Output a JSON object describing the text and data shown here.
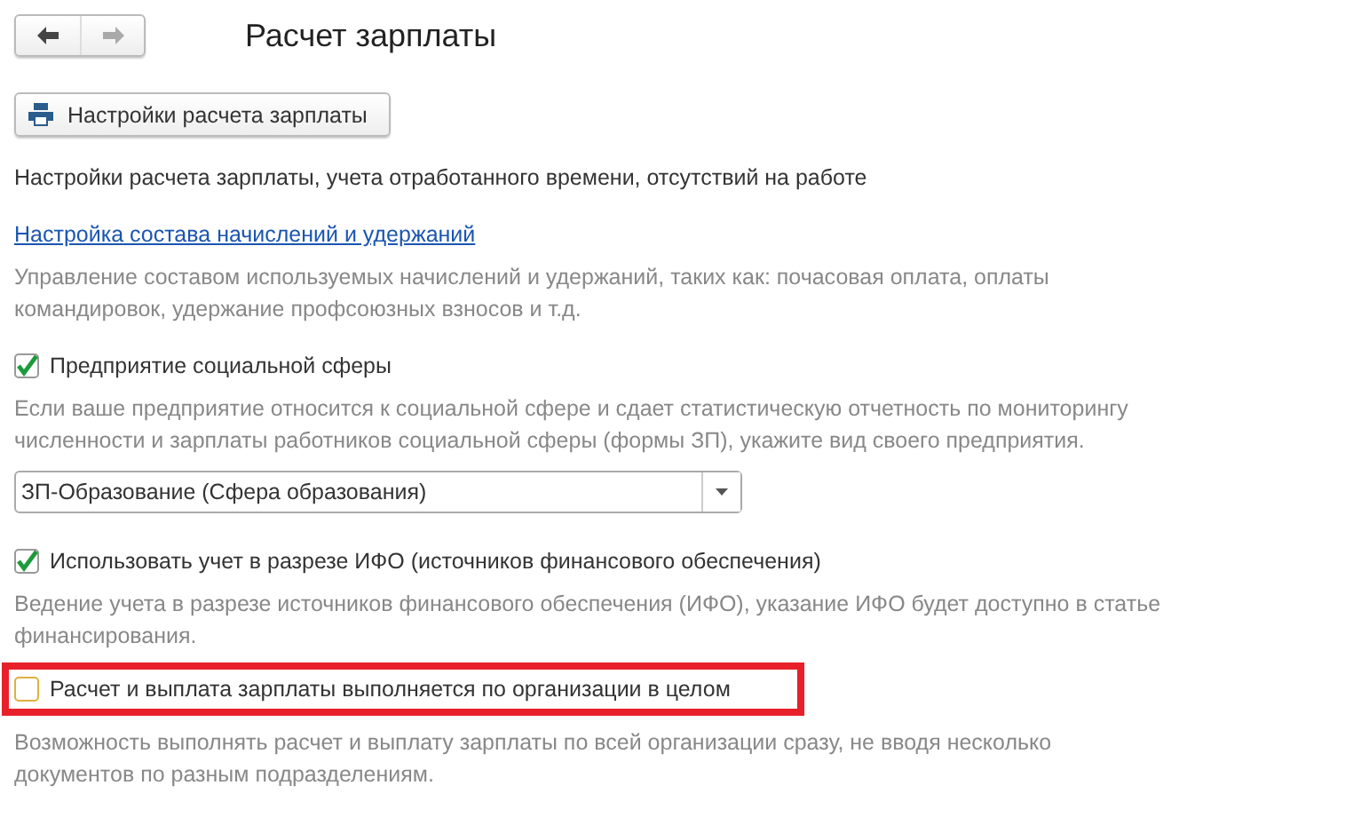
{
  "nav": {
    "back_disabled": false,
    "forward_disabled": true
  },
  "window": {
    "title": "Расчет зарплаты"
  },
  "toolbar": {
    "button": "Настройки расчета зарплаты"
  },
  "subtitle": "Настройки расчета зарплаты, учета отработанного времени, отсутствий на работе",
  "sections": [
    {
      "kind": "link",
      "text": "Настройка состава начислений и удержаний"
    },
    {
      "kind": "note",
      "text": "Управление составом используемых начислений и удержаний, таких как: почасовая оплата, оплаты командировок, удержание профсоюзных взносов и т.д."
    },
    {
      "kind": "checkbox",
      "label": "Предприятие социальной сферы",
      "checked": true,
      "highlighted": false
    },
    {
      "kind": "note",
      "text": "Если ваше предприятие относится к социальной сфере и сдает статистическую отчетность по мониторингу численности и зарплаты работников социальной сферы (формы ЗП), укажите вид своего предприятия."
    },
    {
      "kind": "dropdown",
      "value": "ЗП-Образование (Сфера образования)"
    },
    {
      "kind": "checkbox",
      "label": "Использовать учет в разрезе ИФО (источников финансового обеспечения)",
      "checked": true,
      "highlighted": false
    },
    {
      "kind": "note",
      "text": "Ведение учета в разрезе источников финансового обеспечения (ИФО), указание ИФО будет доступно в статье финансирования."
    },
    {
      "kind": "checkbox",
      "label": "Расчет и выплата зарплаты выполняется по организации в целом",
      "checked": false,
      "highlighted": true
    },
    {
      "kind": "note",
      "text": "Возможность выполнять расчет и выплату зарплаты по всей организации сразу, не вводя несколько документов по разным подразделениям."
    }
  ]
}
